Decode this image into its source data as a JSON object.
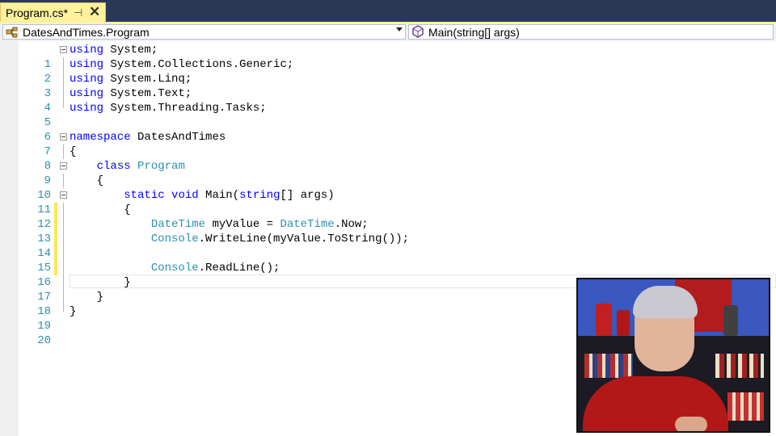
{
  "tab": {
    "title": "Program.cs*",
    "pin_glyph": "⊣",
    "close_glyph": "✕"
  },
  "navigation": {
    "type_dropdown": "DatesAndTimes.Program",
    "member_dropdown": "Main(string[] args)"
  },
  "icons": {
    "type_icon": "class-icon",
    "member_icon": "method-icon",
    "fold_icon": "collapse-icon"
  },
  "colors": {
    "keyword": "#0000ff",
    "type": "#2b91af",
    "line_number": "#2b91af",
    "change_marker": "#fce65a",
    "tab_active": "#fff29d",
    "title_bar": "#293955"
  },
  "editor": {
    "lines": [
      {
        "n": "1"
      },
      {
        "n": "2"
      },
      {
        "n": "3"
      },
      {
        "n": "4"
      },
      {
        "n": "5"
      },
      {
        "n": "6"
      },
      {
        "n": "7"
      },
      {
        "n": "8"
      },
      {
        "n": "9"
      },
      {
        "n": "10"
      },
      {
        "n": "11"
      },
      {
        "n": "12"
      },
      {
        "n": "13"
      },
      {
        "n": "14"
      },
      {
        "n": "15"
      },
      {
        "n": "16"
      },
      {
        "n": "17"
      },
      {
        "n": "18"
      },
      {
        "n": "19"
      },
      {
        "n": "20"
      }
    ],
    "code": {
      "l1": [
        "using",
        " System;"
      ],
      "l2": [
        "using",
        " System.Collections.Generic;"
      ],
      "l3": [
        "using",
        " System.Linq;"
      ],
      "l4": [
        "using",
        " System.Text;"
      ],
      "l5": [
        "using",
        " System.Threading.Tasks;"
      ],
      "l7": [
        "namespace",
        " DatesAndTimes"
      ],
      "l8": "{",
      "l9": [
        "    ",
        "class",
        " ",
        "Program"
      ],
      "l10": "    {",
      "l11": [
        "        ",
        "static",
        " ",
        "void",
        " Main(",
        "string",
        "[] args)"
      ],
      "l12": "        {",
      "l13": [
        "            ",
        "DateTime",
        " myValue = ",
        "DateTime",
        ".Now;"
      ],
      "l14": [
        "            ",
        "Console",
        ".WriteLine(myValue.ToString());"
      ],
      "l16": [
        "            ",
        "Console",
        ".ReadLine();"
      ],
      "l17": "        }",
      "l18": "    }",
      "l19": "}"
    }
  }
}
